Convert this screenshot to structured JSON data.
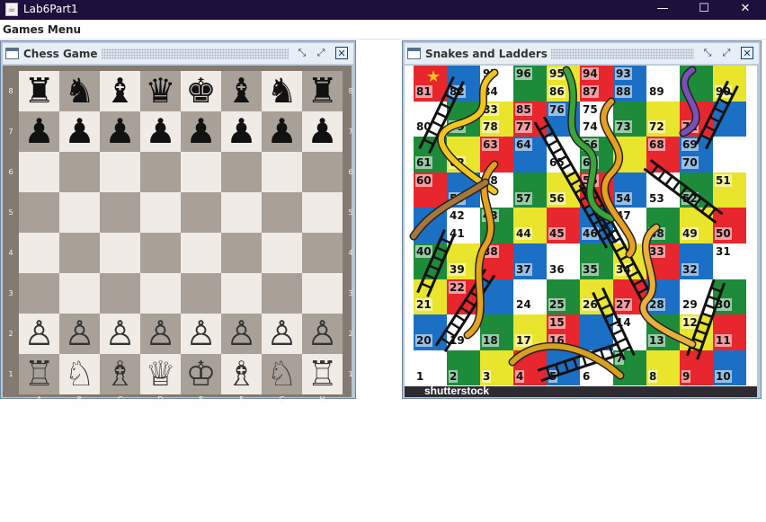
{
  "window": {
    "title": "Lab6Part1",
    "minimize": "—",
    "maximize": "☐",
    "close": "✕",
    "icon": "java-icon"
  },
  "menubar": {
    "items": [
      "Games Menu"
    ]
  },
  "frames": {
    "chess": {
      "title": "Chess Game",
      "icon": "frame-icon"
    },
    "snakes": {
      "title": "Snakes and Ladders",
      "icon": "frame-icon",
      "footer": "shutterstock"
    }
  },
  "frame_controls": {
    "iconify": "⤡",
    "maximize": "⤢",
    "close": "✕"
  },
  "chess": {
    "ranks": [
      "8",
      "7",
      "6",
      "5",
      "4",
      "3",
      "2",
      "1"
    ],
    "files": [
      "A",
      "B",
      "C",
      "D",
      "E",
      "F",
      "G",
      "H"
    ],
    "rows": [
      [
        "♜",
        "♞",
        "♝",
        "♛",
        "♚",
        "♝",
        "♞",
        "♜"
      ],
      [
        "♟",
        "♟",
        "♟",
        "♟",
        "♟",
        "♟",
        "♟",
        "♟"
      ],
      [
        "",
        "",
        "",
        "",
        "",
        "",
        "",
        ""
      ],
      [
        "",
        "",
        "",
        "",
        "",
        "",
        "",
        ""
      ],
      [
        "",
        "",
        "",
        "",
        "",
        "",
        "",
        ""
      ],
      [
        "",
        "",
        "",
        "",
        "",
        "",
        "",
        ""
      ],
      [
        "♙",
        "♙",
        "♙",
        "♙",
        "♙",
        "♙",
        "♙",
        "♙"
      ],
      [
        "♖",
        "♘",
        "♗",
        "♕",
        "♔",
        "♗",
        "♘",
        "♖"
      ]
    ],
    "colors": {
      "light": "#f0ebe5",
      "dark": "#a9a197",
      "border": "#837a72"
    }
  },
  "snakes": {
    "rows": [
      [
        "",
        "",
        "97",
        "96",
        "95",
        "94",
        "93",
        "",
        "",
        ""
      ],
      [
        "81",
        "82",
        "84",
        "",
        "86",
        "87",
        "88",
        "89",
        "",
        "90"
      ],
      [
        "",
        "",
        "83",
        "85",
        "76",
        "75",
        "",
        "",
        "",
        ""
      ],
      [
        "80",
        "79",
        "78",
        "77",
        "",
        "74",
        "73",
        "72",
        "71",
        ""
      ],
      [
        "",
        "",
        "63",
        "64",
        "",
        "66",
        "",
        "68",
        "69",
        ""
      ],
      [
        "61",
        "62",
        "",
        "",
        "65",
        "67",
        "",
        "",
        "70",
        ""
      ],
      [
        "60",
        "",
        "58",
        "",
        "",
        "55",
        "",
        "",
        "",
        "51"
      ],
      [
        "",
        "59",
        "",
        "57",
        "56",
        "",
        "54",
        "53",
        "52",
        ""
      ],
      [
        "",
        "42",
        "43",
        "",
        "",
        "",
        "47",
        "",
        "",
        ""
      ],
      [
        "",
        "41",
        "",
        "44",
        "45",
        "46",
        "",
        "48",
        "49",
        "50"
      ],
      [
        "40",
        "",
        "38",
        "",
        "",
        "",
        "",
        "33",
        "",
        "31"
      ],
      [
        "",
        "39",
        "",
        "37",
        "36",
        "35",
        "34",
        "",
        "32",
        ""
      ],
      [
        "",
        "22",
        "",
        "",
        "",
        "",
        "",
        "",
        "",
        ""
      ],
      [
        "21",
        "",
        "",
        "24",
        "25",
        "26",
        "27",
        "28",
        "29",
        "30"
      ],
      [
        "",
        "",
        "",
        "",
        "15",
        "",
        "14",
        "",
        "12",
        ""
      ],
      [
        "20",
        "19",
        "18",
        "17",
        "16",
        "",
        "",
        "13",
        "",
        "11"
      ],
      [
        "",
        "",
        "",
        "",
        "",
        "",
        "7",
        "",
        "",
        ""
      ],
      [
        "1",
        "2",
        "3",
        "4",
        "5",
        "6",
        "",
        "8",
        "9",
        "10"
      ]
    ]
  }
}
